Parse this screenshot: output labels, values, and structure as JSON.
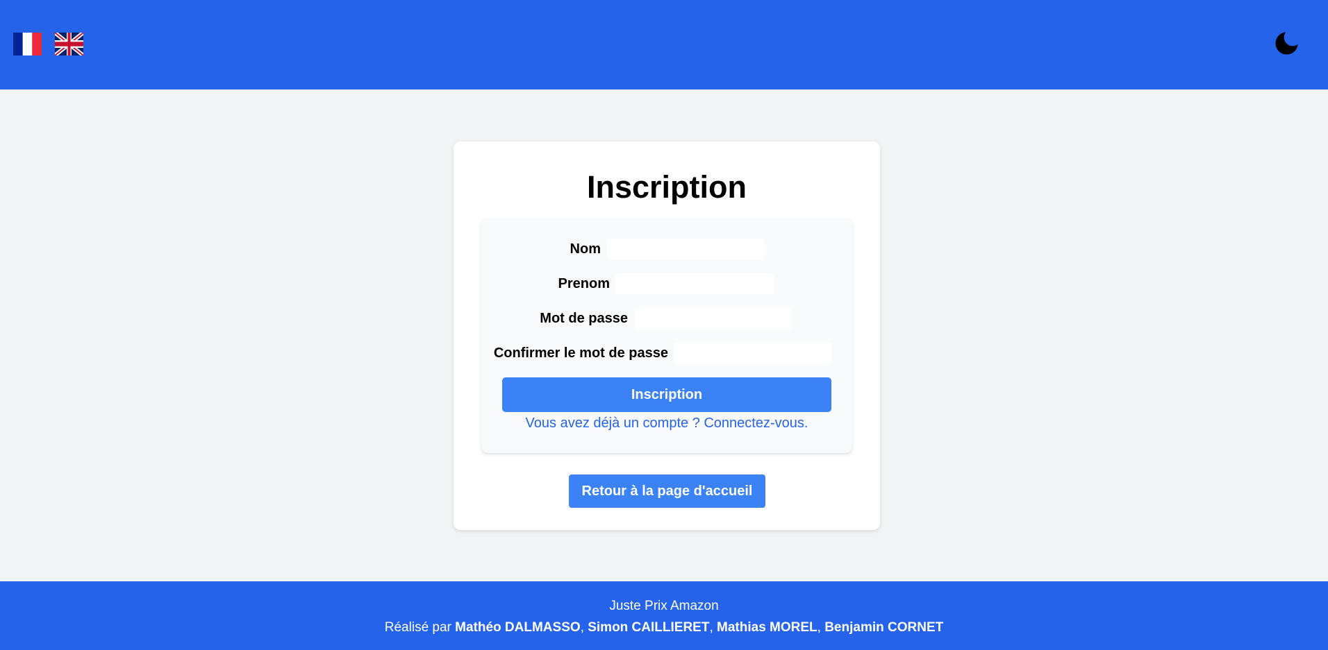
{
  "header": {
    "languages": [
      {
        "code": "fr",
        "icon": "france-flag-icon"
      },
      {
        "code": "en",
        "icon": "uk-flag-icon"
      }
    ],
    "theme_toggle_icon": "moon-icon",
    "background_color": "#2563eb"
  },
  "form": {
    "title": "Inscription",
    "fields": [
      {
        "label": "Nom",
        "value": "",
        "placeholder": ""
      },
      {
        "label": "Prenom",
        "value": "",
        "placeholder": ""
      },
      {
        "label": "Mot de passe",
        "value": "",
        "placeholder": ""
      },
      {
        "label": "Confirmer le mot de passe",
        "value": "",
        "placeholder": ""
      }
    ],
    "submit_label": "Inscription",
    "login_link_text": "Vous avez déjà un compte ? Connectez-vous.",
    "accent_color": "#3b82f6",
    "link_color": "#2563eb"
  },
  "home_button_label": "Retour à la page d'accueil",
  "footer": {
    "app_name": "Juste Prix Amazon",
    "credits_prefix": "Réalisé par",
    "authors": [
      "Mathéo DALMASSO",
      "Simon CAILLIERET",
      "Mathias MOREL",
      "Benjamin CORNET"
    ],
    "separator": ","
  }
}
